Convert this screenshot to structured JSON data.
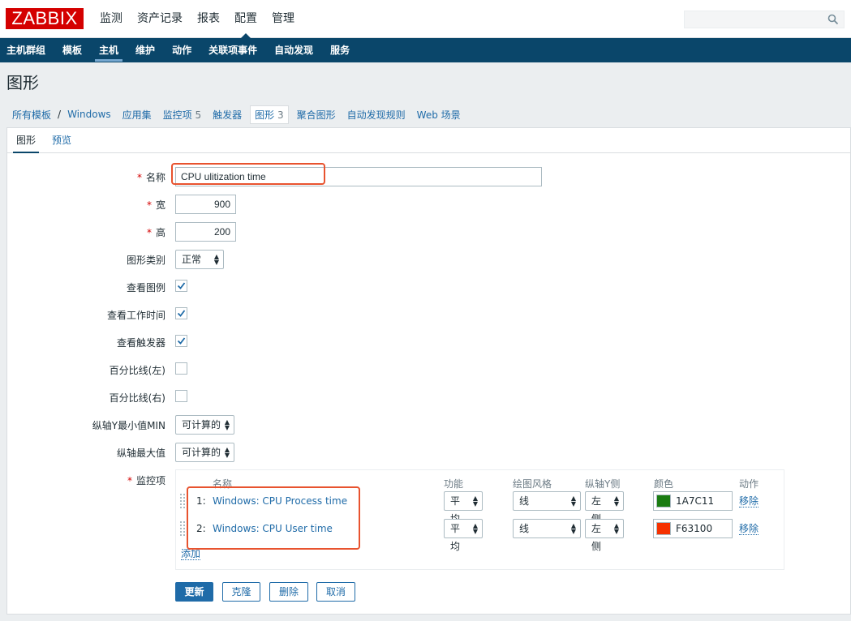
{
  "header": {
    "logo": "ZABBIX",
    "nav": [
      "监测",
      "资产记录",
      "报表",
      "配置",
      "管理"
    ],
    "active_nav": "配置",
    "search_placeholder": ""
  },
  "subnav": {
    "items": [
      "主机群组",
      "模板",
      "主机",
      "维护",
      "动作",
      "关联项事件",
      "自动发现",
      "服务"
    ],
    "active": "主机"
  },
  "page_title": "图形",
  "objnav": {
    "all_templates": "所有模板",
    "separator": "/",
    "host": "Windows",
    "applications": "应用集",
    "items_label": "监控项",
    "items_count": "5",
    "triggers": "触发器",
    "graphs_label": "图形",
    "graphs_count": "3",
    "screens": "聚合图形",
    "discovery": "自动发现规则",
    "web": "Web 场景"
  },
  "tabs": {
    "graph": "图形",
    "preview": "预览"
  },
  "form": {
    "required_mark": "*",
    "name_label": "名称",
    "name_value": "CPU ulitization time",
    "width_label": "宽",
    "width_value": "900",
    "height_label": "高",
    "height_value": "200",
    "graph_type_label": "图形类别",
    "graph_type_value": "正常",
    "show_legend_label": "查看图例",
    "show_legend": true,
    "show_working_time_label": "查看工作时间",
    "show_working_time": true,
    "show_triggers_label": "查看触发器",
    "show_triggers": true,
    "percentile_left_label": "百分比线(左)",
    "percentile_left": false,
    "percentile_right_label": "百分比线(右)",
    "percentile_right": false,
    "ymin_label": "纵轴Y最小值MIN",
    "ymin_value": "可计算的",
    "ymax_label": "纵轴最大值",
    "ymax_value": "可计算的",
    "items_label": "监控项"
  },
  "items_table": {
    "headers": {
      "name": "名称",
      "function": "功能",
      "draw_style": "绘图风格",
      "y_axis_side": "纵轴Y侧",
      "color": "颜色",
      "action": "动作"
    },
    "rows": [
      {
        "index": "1:",
        "name": "Windows: CPU Process time",
        "function": "平均",
        "draw_style": "线",
        "y_side": "左侧",
        "color": "1A7C11",
        "swatch": "#1a7c11",
        "action": "移除"
      },
      {
        "index": "2:",
        "name": "Windows: CPU User time",
        "function": "平均",
        "draw_style": "线",
        "y_side": "左侧",
        "color": "F63100",
        "swatch": "#f63100",
        "action": "移除"
      }
    ],
    "add": "添加"
  },
  "buttons": {
    "update": "更新",
    "clone": "克隆",
    "delete": "删除",
    "cancel": "取消"
  }
}
